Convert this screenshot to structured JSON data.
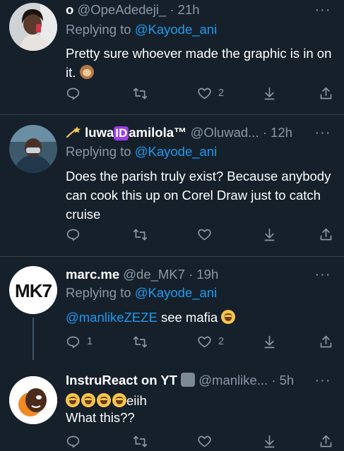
{
  "replying_label": "Replying to",
  "tweets": [
    {
      "display_name": "o",
      "handle": "@OpeAdedeji_",
      "time": "· 21h",
      "reply_to": "@Kayode_ani",
      "text_1": "Pretty sure whoever made the graphic is in on it.",
      "emoji": "see-no-evil-monkey",
      "reply_count": "",
      "retweet_count": "",
      "like_count": "2"
    },
    {
      "display_name_a": "luwa",
      "display_name_badge": "ID",
      "display_name_b": "amilola™",
      "handle": "@Oluwad...",
      "time": "· 12h",
      "reply_to": "@Kayode_ani",
      "text_1": "Does the parish truly exist? Because anybody can cook this up on Corel Draw just to catch cruise",
      "reply_count": "",
      "retweet_count": "",
      "like_count": ""
    },
    {
      "display_name": "marc.me",
      "handle": "@de_MK7",
      "time": "· 19h",
      "reply_to": "@Kayode_ani",
      "avatar_text": "MK7",
      "mention": "@manlikeZEZE",
      "text_1": " see mafia ",
      "emoji": "face-with-tears-of-joy",
      "reply_count": "1",
      "retweet_count": "",
      "like_count": "2"
    },
    {
      "display_name": "InstruReact on YT",
      "handle": "@manlike...",
      "time": "· 5h",
      "text_1": "eiih",
      "text_2": "What this??",
      "emoji": "face-with-tears-of-joy",
      "reply_count": "",
      "retweet_count": "",
      "like_count": ""
    }
  ],
  "colors": {
    "background": "#15202b",
    "divider": "#38444d",
    "link": "#1d9bf0",
    "muted": "#8b98a5"
  },
  "icons": [
    "reply-icon",
    "retweet-icon",
    "like-icon",
    "download-icon",
    "share-icon",
    "more-icon"
  ]
}
